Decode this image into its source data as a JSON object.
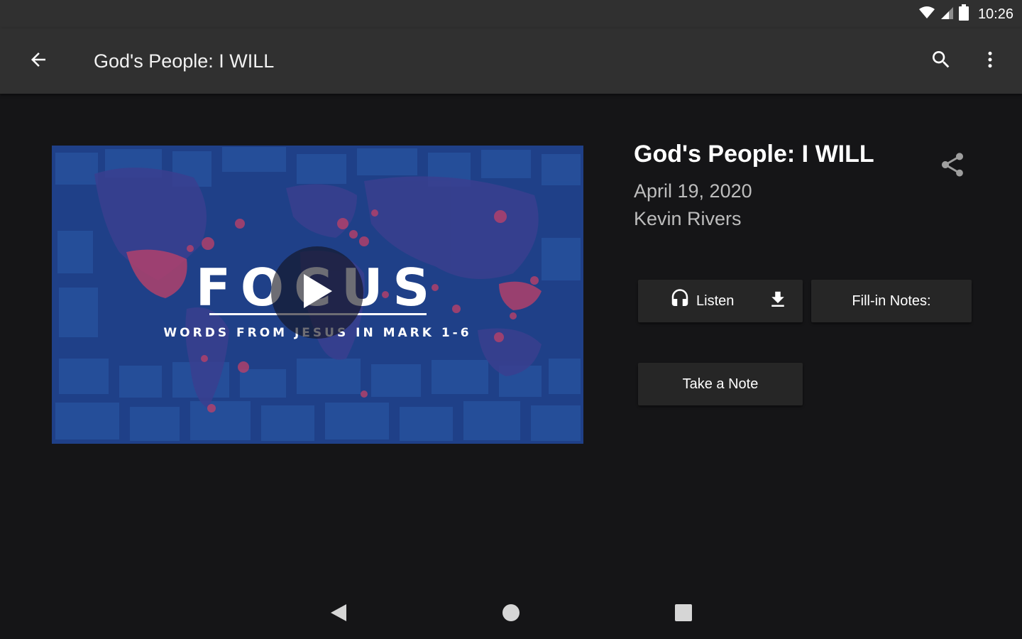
{
  "status_bar": {
    "time": "10:26",
    "icons": [
      "wifi-icon",
      "cell-signal-icon",
      "battery-icon"
    ]
  },
  "app_bar": {
    "title": "God's People: I WILL",
    "icons": [
      "back-arrow-icon",
      "search-icon",
      "more-vert-icon"
    ]
  },
  "media": {
    "series_title": "FOCUS",
    "series_subtitle": "WORDS FROM JESUS IN MARK 1-6",
    "play_icon": "play-icon"
  },
  "details": {
    "title": "God's People: I WILL",
    "date": "April 19, 2020",
    "speaker": "Kevin Rivers",
    "share_icon": "share-icon"
  },
  "actions": {
    "listen_label": "Listen",
    "fill_in_notes_label": "Fill-in Notes:",
    "take_note_label": "Take a Note"
  },
  "nav_bar": {
    "icons": [
      "nav-back-icon",
      "nav-home-icon",
      "nav-recents-icon"
    ]
  },
  "colors": {
    "app_bar": "#303030",
    "background": "#151517",
    "button": "#262626",
    "secondary_text": "#bdbdbd",
    "thumb_blue": "#1e3f86",
    "thumb_dots": "#b8416a"
  }
}
